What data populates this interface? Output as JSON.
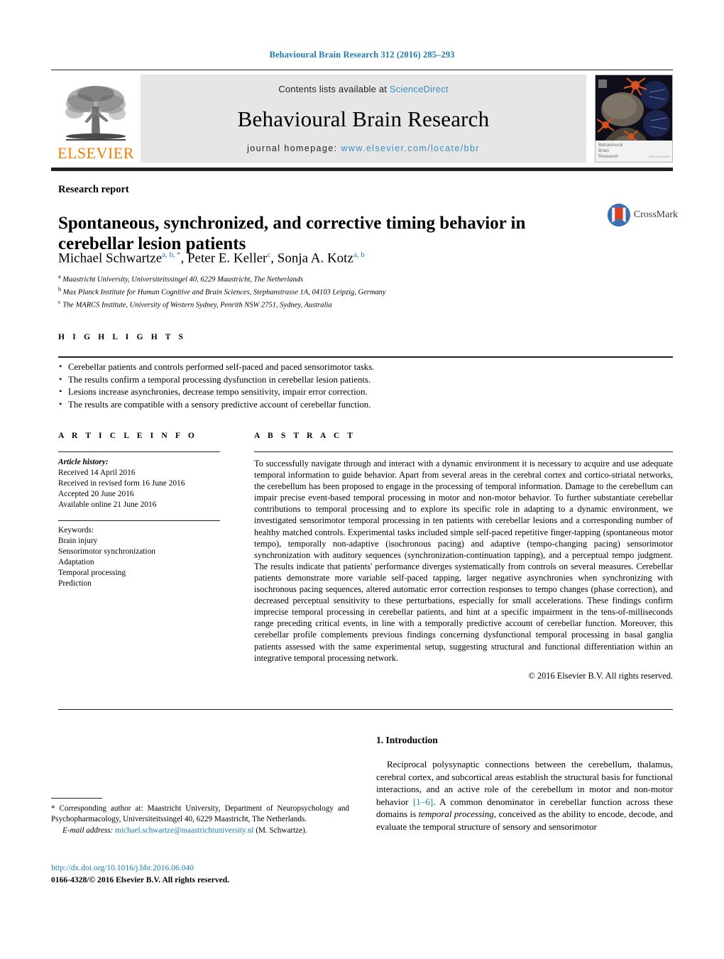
{
  "running_head": "Behavioural Brain Research 312 (2016) 285–293",
  "masthead": {
    "contents_prefix": "Contents lists available at ",
    "contents_link": "ScienceDirect",
    "journal_title": "Behavioural Brain Research",
    "homepage_prefix": "journal homepage: ",
    "homepage_url": "www.elsevier.com/locate/bbr",
    "publisher": "ELSEVIER",
    "cover_caption_line1": "Behavioural",
    "cover_caption_line2": "Brain",
    "cover_caption_line3": "Research",
    "cover_issn": "ISSN 0166-4328"
  },
  "article": {
    "doctype": "Research report",
    "title": "Spontaneous, synchronized, and corrective timing behavior in cerebellar lesion patients",
    "crossmark_label": "CrossMark",
    "authors_html": "Michael Schwartze<sup>a, b, *</sup>, Peter E. Keller<sup>c</sup>, Sonja A. Kotz<sup>a, b</sup>",
    "affiliations": [
      {
        "mark": "a",
        "text": "Maastricht University, Universiteitssingel 40, 6229 Maastricht, The Netherlands"
      },
      {
        "mark": "b",
        "text": "Max Planck Institute for Human Cognitive and Brain Sciences, Stephanstrasse 1A, 04103 Leipzig, Germany"
      },
      {
        "mark": "c",
        "text": "The MARCS Institute, University of Western Sydney, Penrith NSW 2751, Sydney, Australia"
      }
    ]
  },
  "highlights": {
    "label": "H I G H L I G H T S",
    "items": [
      "Cerebellar patients and controls performed self-paced and paced sensorimotor tasks.",
      "The results confirm a temporal processing dysfunction in cerebellar lesion patients.",
      "Lesions increase asynchronies, decrease tempo sensitivity, impair error correction.",
      "The results are compatible with a sensory predictive account of cerebellar function."
    ]
  },
  "article_info": {
    "label": "A R T I C L E   I N F O",
    "history_label": "Article history:",
    "history": [
      "Received 14 April 2016",
      "Received in revised form 16 June 2016",
      "Accepted 20 June 2016",
      "Available online 21 June 2016"
    ],
    "keywords_label": "Keywords:",
    "keywords": [
      "Brain injury",
      "Sensorimotor synchronization",
      "Adaptation",
      "Temporal processing",
      "Prediction"
    ]
  },
  "abstract": {
    "label": "A B S T R A C T",
    "text": "To successfully navigate through and interact with a dynamic environment it is necessary to acquire and use adequate temporal information to guide behavior. Apart from several areas in the cerebral cortex and cortico-striatal networks, the cerebellum has been proposed to engage in the processing of temporal information. Damage to the cerebellum can impair precise event-based temporal processing in motor and non-motor behavior. To further substantiate cerebellar contributions to temporal processing and to explore its specific role in adapting to a dynamic environment, we investigated sensorimotor temporal processing in ten patients with cerebellar lesions and a corresponding number of healthy matched controls. Experimental tasks included simple self-paced repetitive finger-tapping (spontaneous motor tempo), temporally non-adaptive (isochronous pacing) and adaptive (tempo-changing pacing) sensorimotor synchronization with auditory sequences (synchronization-continuation tapping), and a perceptual tempo judgment. The results indicate that patients' performance diverges systematically from controls on several measures. Cerebellar patients demonstrate more variable self-paced tapping, larger negative asynchronies when synchronizing with isochronous pacing sequences, altered automatic error correction responses to tempo changes (phase correction), and decreased perceptual sensitivity to these perturbations, especially for small accelerations. These findings confirm imprecise temporal processing in cerebellar patients, and hint at a specific impairment in the tens-of-milliseconds range preceding critical events, in line with a temporally predictive account of cerebellar function. Moreover, this cerebellar profile complements previous findings concerning dysfunctional temporal processing in basal ganglia patients assessed with the same experimental setup, suggesting structural and functional differentiation within an integrative temporal processing network.",
    "copyright": "© 2016 Elsevier B.V. All rights reserved."
  },
  "introduction": {
    "heading": "1.  Introduction",
    "paragraph_part1": "Reciprocal polysynaptic connections between the cerebellum, thalamus, cerebral cortex, and subcortical areas establish the structural basis for functional interactions, and an active role of the cerebellum in motor and non-motor behavior ",
    "reference": "[1–6]",
    "paragraph_part2": ". A common denominator in cerebellar function across these domains is ",
    "italic_phrase": "temporal processing",
    "paragraph_part3": ", conceived as the ability to encode, decode, and evaluate the temporal structure of sensory and sensorimotor"
  },
  "footnote": {
    "star": "*",
    "corresponding_text": "Corresponding author at: Maastricht University, Department of Neuropsychology and Psychopharmacology, Universiteitssingel 40, 6229 Maastricht, The Netherlands.",
    "email_label": "E-mail address:",
    "email": "michael.schwartze@maastrichtuniversity.nl",
    "email_suffix": "(M. Schwartze)."
  },
  "footer": {
    "doi": "http://dx.doi.org/10.1016/j.bbr.2016.06.040",
    "issn_line": "0166-4328/© 2016 Elsevier B.V. All rights reserved."
  },
  "colors": {
    "link": "#1a7cb0",
    "sciencedirect": "#3a8fc0",
    "elsevier_orange": "#f07c00",
    "rule": "#231f20",
    "masthead_bg": "#e6e6e6"
  }
}
